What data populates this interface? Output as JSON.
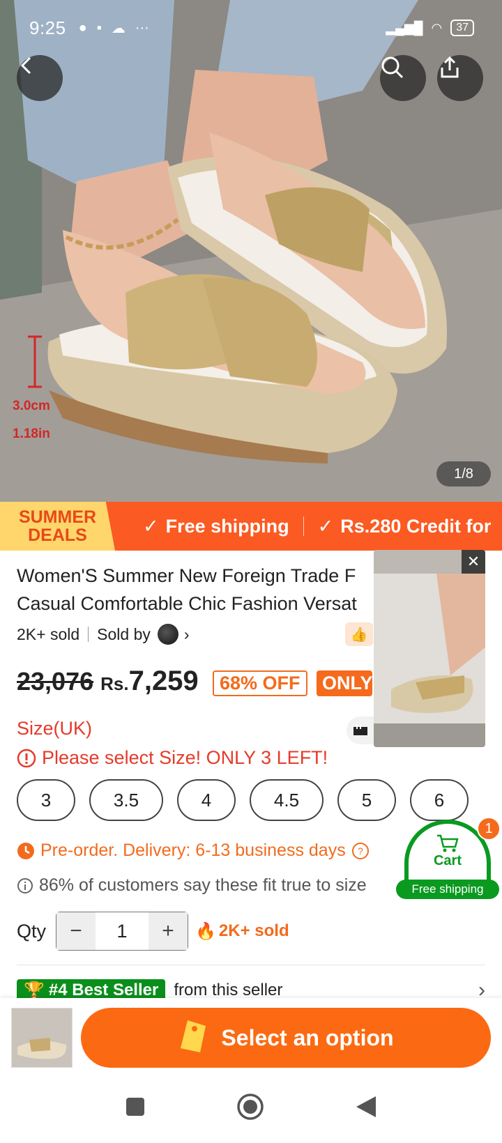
{
  "status": {
    "time": "9:25",
    "battery": "37"
  },
  "hero": {
    "counter": "1/8",
    "measure_cm": "3.0cm",
    "measure_in": "1.18in"
  },
  "banner": {
    "summer_line1": "SUMMER",
    "summer_line2": "DEALS",
    "item1": "Free shipping",
    "item2": "Rs.280 Credit for"
  },
  "product": {
    "title_line1": "Women'S Summer New Foreign Trade F",
    "title_line2": "Casual Comfortable Chic Fashion Versat",
    "sold": "2K+ sold",
    "sold_by": "Sold by",
    "old_price": "23,076",
    "currency": "Rs.",
    "new_price": "7,259",
    "discount": "68% OFF",
    "only_badge": "ONLY"
  },
  "size": {
    "label": "Size(UK)",
    "warning": "Please select Size! ONLY 3 LEFT!",
    "options": [
      "3",
      "3.5",
      "4",
      "4.5",
      "5",
      "6"
    ]
  },
  "info": {
    "preorder": "Pre-order. Delivery: 6-13 business days",
    "fit": "86% of customers say these fit true to size"
  },
  "qty": {
    "label": "Qty",
    "value": "1",
    "minus": "−",
    "plus": "+",
    "hot": "2K+ sold"
  },
  "best": {
    "badge": "#4 Best Seller",
    "text": "from this seller"
  },
  "cart": {
    "label": "Cart",
    "count": "1",
    "free": "Free shipping"
  },
  "cta": {
    "label": "Select an option"
  },
  "colors": {
    "accent": "#fb6a12",
    "banner": "#fb5a22",
    "green": "#0a9a20",
    "warn": "#e53a2a"
  }
}
